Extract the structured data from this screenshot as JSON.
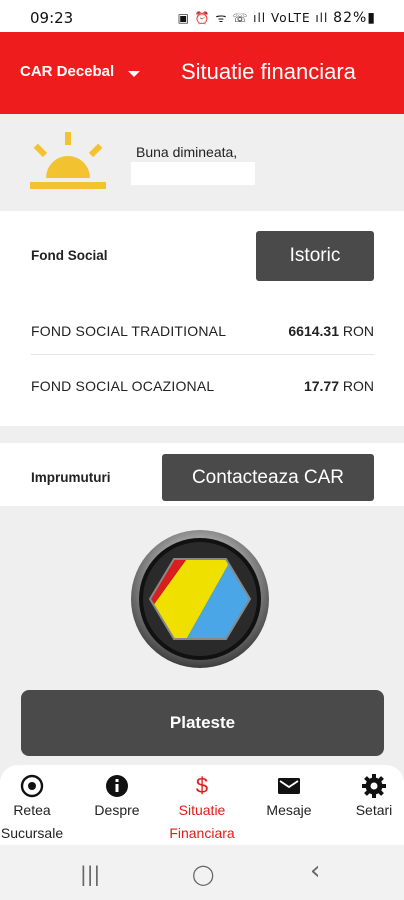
{
  "status_bar": {
    "time": "09:23",
    "icons": "▣ ⏰ ᯤ ☏ ıll VoLTE ıll",
    "battery": "82%▮"
  },
  "header": {
    "org_name": "CAR Decebal",
    "title": "Situatie financiara",
    "accent_color": "#ee1c1c"
  },
  "greeting": {
    "text": "Buna dimineata,",
    "icon": "sunrise-icon"
  },
  "fond": {
    "title": "Fond Social",
    "history_button": "Istoric",
    "rows": [
      {
        "label": "FOND SOCIAL TRADITIONAL",
        "amount": "6614.31",
        "currency": " RON"
      },
      {
        "label": "FOND SOCIAL OCAZIONAL",
        "amount": "17.77",
        "currency": " RON"
      }
    ]
  },
  "imprumuturi": {
    "title": "Imprumuturi",
    "contact_button": "Contacteaza CAR"
  },
  "pay_button": "Plateste",
  "bottom_nav": [
    {
      "label": "Retea Sucursale",
      "icon": "target-icon"
    },
    {
      "label": "Despre",
      "icon": "info-icon"
    },
    {
      "label": "Situatie Financiara",
      "icon": "dollar-icon",
      "active": true
    },
    {
      "label": "Mesaje",
      "icon": "mail-icon"
    },
    {
      "label": "Setari",
      "icon": "gear-icon"
    }
  ],
  "bottom_nav_lines": {
    "retea_1": "Retea",
    "retea_2": "Sucursale",
    "situatie_1": "Situatie",
    "situatie_2": "Financiara",
    "dollar": "$"
  },
  "system_nav": {
    "recents": "|||",
    "home": "◯",
    "back": "‹"
  }
}
